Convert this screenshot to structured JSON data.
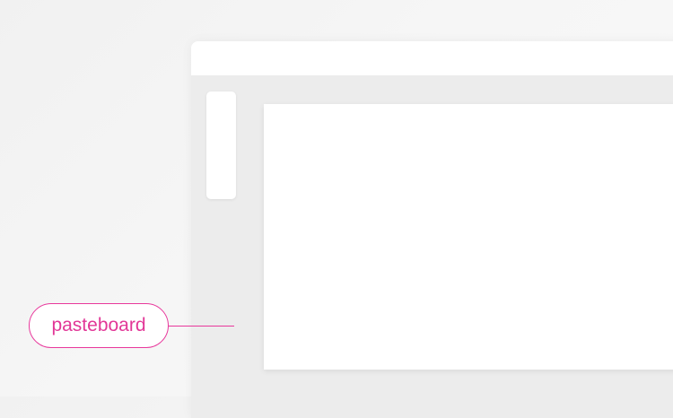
{
  "callout": {
    "label": "pasteboard",
    "color": "#e8389c"
  },
  "colors": {
    "background": "#f5f5f5",
    "window": "#ffffff",
    "pasteboard": "#ececec",
    "canvas": "#ffffff"
  }
}
